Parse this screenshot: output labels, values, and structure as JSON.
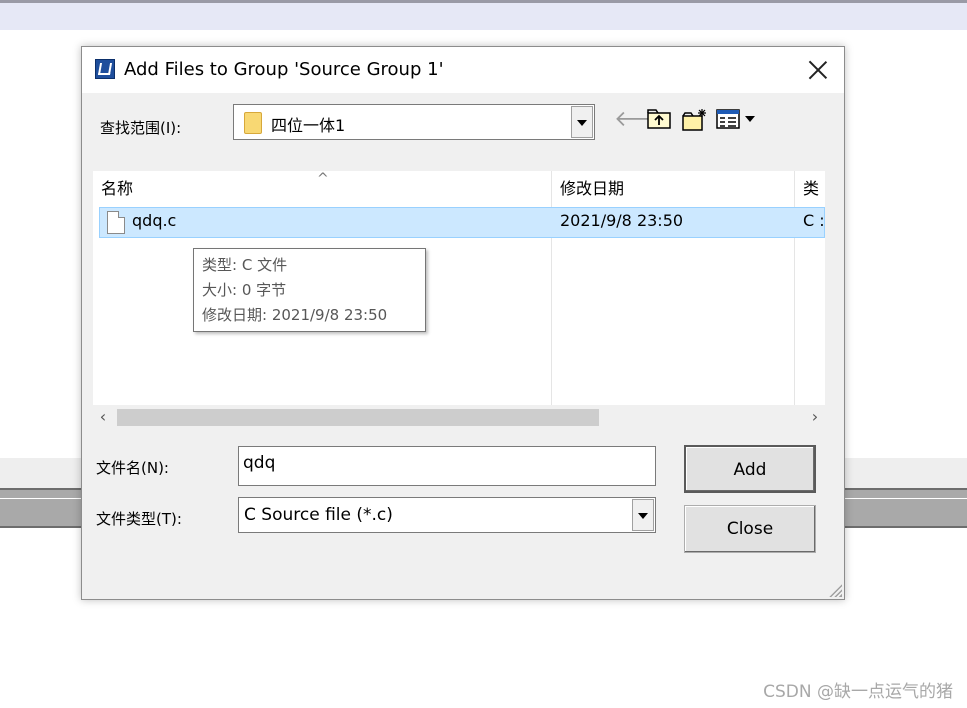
{
  "dialog": {
    "title": "Add Files to Group 'Source Group 1'",
    "look_in_label": "查找范围(I):",
    "look_in_value": "四位一体1",
    "toolbar_icons": [
      "back-arrow-icon",
      "up-folder-icon",
      "new-folder-icon",
      "view-menu-icon"
    ]
  },
  "file_list": {
    "columns": [
      "名称",
      "修改日期",
      "类"
    ],
    "rows": [
      {
        "name": "qdq.c",
        "modified": "2021/9/8 23:50",
        "type": "C :"
      }
    ],
    "selected_row": 0
  },
  "tooltip": {
    "type": "类型: C 文件",
    "size": "大小: 0 字节",
    "modified": "修改日期: 2021/9/8 23:50"
  },
  "form": {
    "filename_label": "文件名(N):",
    "filename_value": "qdq",
    "filetype_label": "文件类型(T):",
    "filetype_value": "C Source file (*.c)"
  },
  "buttons": {
    "add": "Add",
    "close": "Close"
  },
  "watermark": "CSDN @缺一点运气的猪",
  "colors": {
    "selection": "#cce8ff",
    "dialog_bg": "#f0f0f0",
    "title_bar": "#ffffff"
  }
}
